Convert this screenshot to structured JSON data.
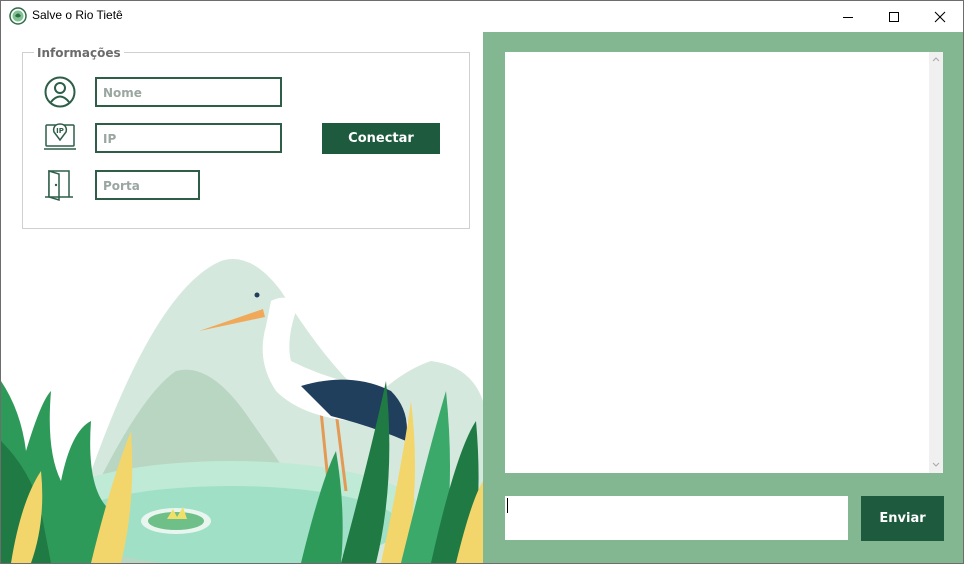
{
  "window": {
    "title": "Salve o Rio Tietê",
    "controls": {
      "minimize": "minimize-icon",
      "maximize": "maximize-icon",
      "close": "close-icon"
    }
  },
  "info_panel": {
    "legend": "Informações",
    "fields": {
      "name": {
        "placeholder": "Nome",
        "icon": "user-icon"
      },
      "ip": {
        "placeholder": "IP",
        "icon": "ip-location-icon"
      },
      "port": {
        "placeholder": "Porta",
        "icon": "door-icon"
      }
    },
    "connect_label": "Conectar"
  },
  "chat": {
    "send_label": "Enviar",
    "message_value": ""
  },
  "colors": {
    "primary_green": "#1e5a3e",
    "panel_green": "#82b791",
    "field_border": "#2e5e48"
  }
}
